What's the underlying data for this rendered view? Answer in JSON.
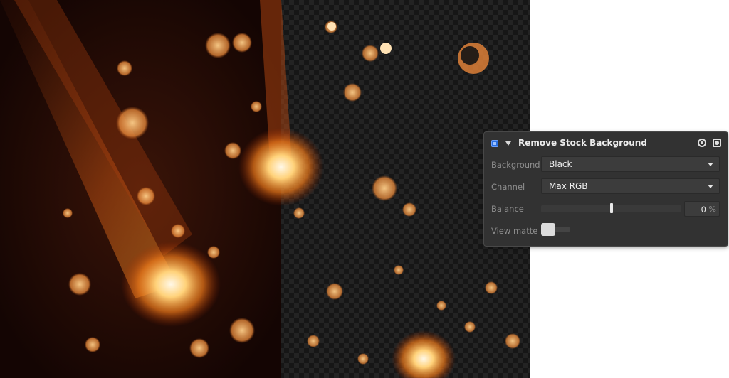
{
  "panel": {
    "title": "Remove Stock Background",
    "enabled": true,
    "icons": {
      "checkbox": "checkbox-icon",
      "collapse": "triangle-down-icon",
      "reset": "reset-icon",
      "mask": "mask-icon"
    },
    "fields": {
      "background": {
        "label": "Background",
        "value": "Black"
      },
      "channel": {
        "label": "Channel",
        "value": "Max RGB"
      },
      "balance": {
        "label": "Balance",
        "value": "0",
        "unit": "%",
        "level": 0.5
      },
      "view_matte": {
        "label": "View matte",
        "on": false
      }
    }
  },
  "colors": {
    "accent": "#2a6fe0",
    "panel_bg": "#323232",
    "checker_dark": "#151515",
    "checker_light": "#222222"
  }
}
